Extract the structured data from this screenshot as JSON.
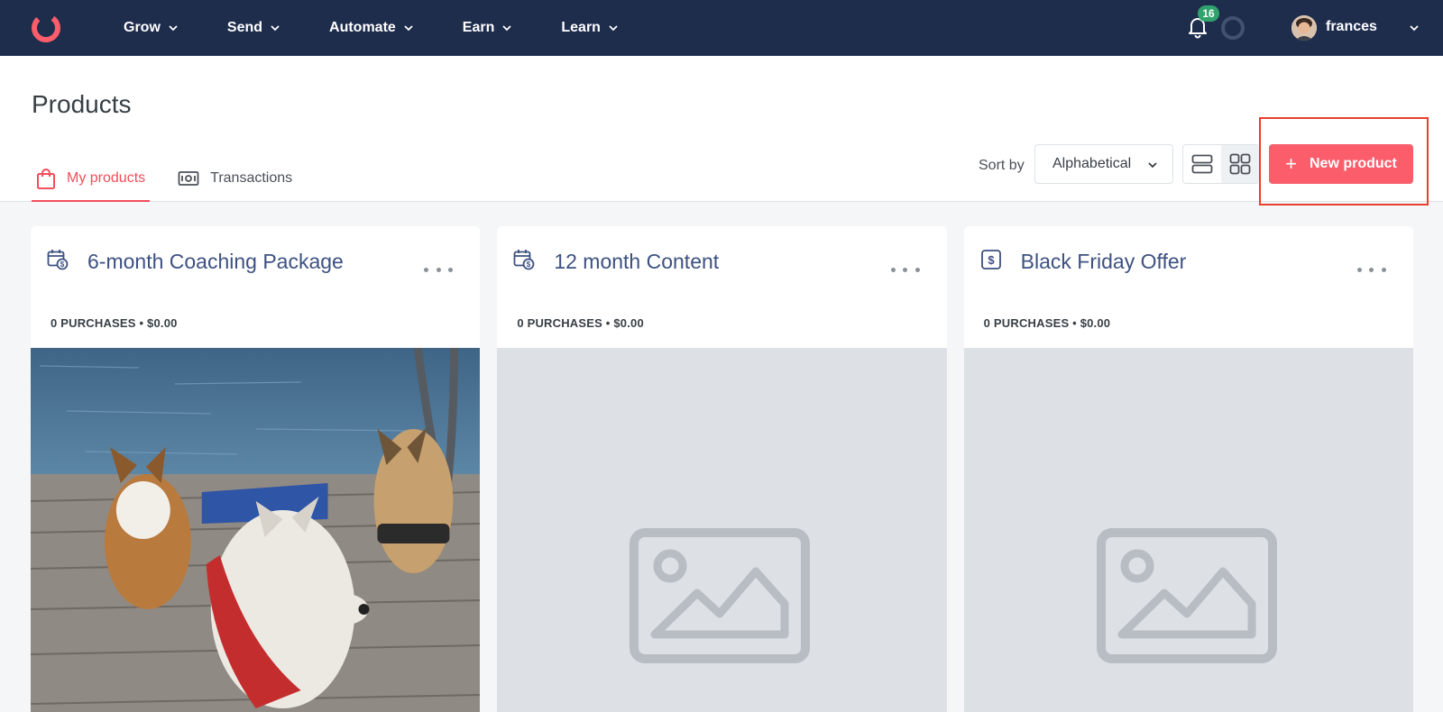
{
  "nav": {
    "items": [
      {
        "label": "Grow"
      },
      {
        "label": "Send"
      },
      {
        "label": "Automate"
      },
      {
        "label": "Earn"
      },
      {
        "label": "Learn"
      }
    ],
    "notification_count": "16",
    "user_name": "frances"
  },
  "page": {
    "title": "Products",
    "tabs": [
      {
        "label": "My products",
        "active": true
      },
      {
        "label": "Transactions",
        "active": false
      }
    ],
    "sort_label": "Sort by",
    "sort_value": "Alphabetical",
    "new_button_label": "New product"
  },
  "products": [
    {
      "title": "6-month Coaching Package",
      "meta": "0 PURCHASES • $0.00",
      "icon": "calendar-dollar-icon",
      "has_image": true
    },
    {
      "title": "12 month Content",
      "meta": "0 PURCHASES • $0.00",
      "icon": "calendar-dollar-icon",
      "has_image": false
    },
    {
      "title": "Black Friday Offer",
      "meta": "0 PURCHASES • $0.00",
      "icon": "dollar-tag-icon",
      "has_image": false
    }
  ],
  "colors": {
    "nav_bg": "#1f2d4d",
    "accent": "#fb5d6b",
    "tab_active": "#f24e5b",
    "title_blue": "#3d5181",
    "badge_green": "#2fa36b",
    "highlight": "#e8402e"
  }
}
